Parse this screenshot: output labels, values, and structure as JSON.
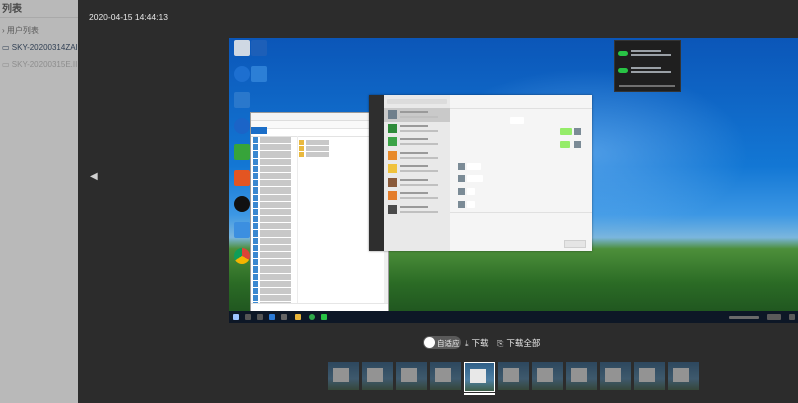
{
  "background_app": {
    "title": "列表",
    "tree_root": "› 用户列表",
    "node_1": "SKY-20200314ZAI",
    "node_2": "SKY-20200315E.II"
  },
  "viewer": {
    "timestamp": "2020-04-15 14:44:13",
    "nav_prev_glyph": "◀",
    "toggle_label": "自适应",
    "download_icon": "⤓",
    "download_label": "下载",
    "download_all_icon": "⎘",
    "download_all_label": "下载全部",
    "thumbnail_count": 11,
    "selected_thumbnail_index": 5
  },
  "colors": {
    "overlay": "#2c2c2c",
    "desktop_blue": "#1377d4",
    "wechat_green": "#28c445",
    "selected_border": "#ffffff"
  }
}
